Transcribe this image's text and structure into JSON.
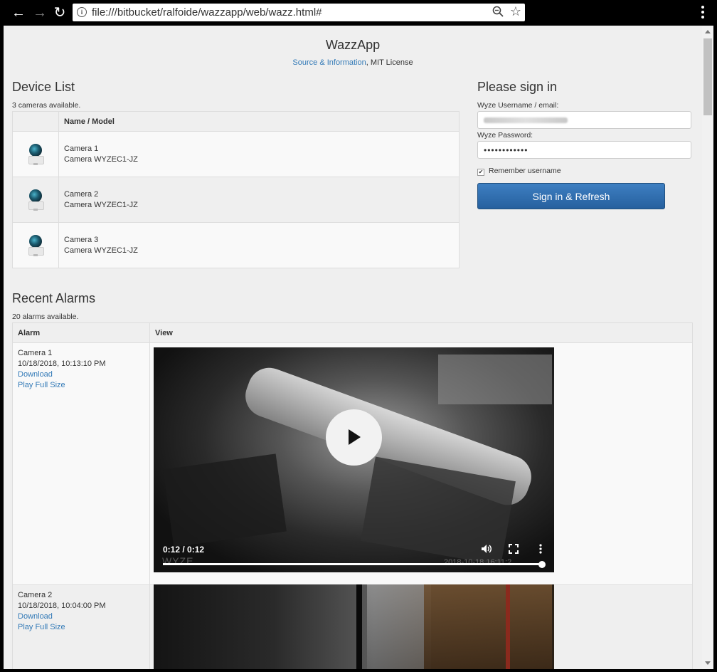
{
  "browser": {
    "url": "file:///bitbucket/ralfoide/wazzapp/web/wazz.html#"
  },
  "header": {
    "title": "WazzApp",
    "source_link": "Source & Information",
    "separator": ",",
    "license": "MIT License"
  },
  "device_list": {
    "heading": "Device List",
    "count_text": "3 cameras available.",
    "column_header": "Name / Model",
    "devices": [
      {
        "name": "Camera 1",
        "model": "Camera WYZEC1-JZ",
        "icon": "camera-icon"
      },
      {
        "name": "Camera 2",
        "model": "Camera WYZEC1-JZ",
        "icon": "camera-icon"
      },
      {
        "name": "Camera 3",
        "model": "Camera WYZEC1-JZ",
        "icon": "camera-icon"
      }
    ]
  },
  "signin": {
    "heading": "Please sign in",
    "username_label": "Wyze Username / email:",
    "password_label": "Wyze Password:",
    "password_value": "••••••••••••",
    "remember_label": "Remember username",
    "remember_checked": true,
    "button_label": "Sign in & Refresh"
  },
  "alarms": {
    "heading": "Recent Alarms",
    "count_text": "20 alarms available.",
    "col_alarm": "Alarm",
    "col_view": "View",
    "items": [
      {
        "camera": "Camera 1",
        "time": "10/18/2018, 10:13:10 PM",
        "download": "Download",
        "play_full": "Play Full Size",
        "video_time": "0:12 / 0:12",
        "video_progress": 1.0,
        "video_watermark": "WYZE",
        "video_stamp": "2018-10-18 16:11:2"
      },
      {
        "camera": "Camera 2",
        "time": "10/18/2018, 10:04:00 PM",
        "download": "Download",
        "play_full": "Play Full Size"
      }
    ]
  },
  "colors": {
    "link": "#337ab7",
    "button": "#2f6aa8",
    "page_bg": "#efefef"
  }
}
